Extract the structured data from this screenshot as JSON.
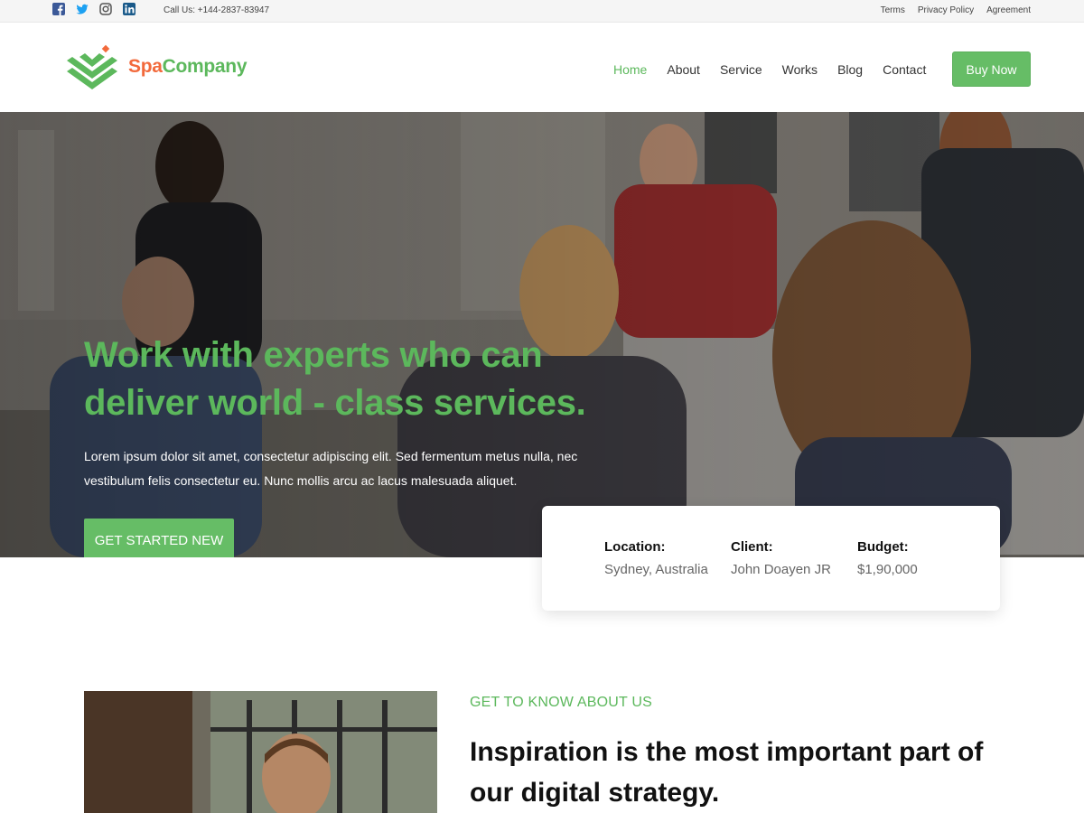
{
  "topbar": {
    "social_icons": [
      "facebook-icon",
      "twitter-icon",
      "instagram-icon",
      "linkedin-icon"
    ],
    "social_color": "#3b5998",
    "call_text": "Call Us: +144-2837-83947",
    "links": [
      "Terms",
      "Privacy Policy",
      "Agreement"
    ]
  },
  "header": {
    "logo": {
      "spa": "Spa",
      "company": "Company"
    },
    "nav": [
      "Home",
      "About",
      "Service",
      "Works",
      "Blog",
      "Contact"
    ],
    "active_nav": "Home",
    "buy_button": "Buy Now"
  },
  "hero": {
    "title": "Work with experts who can deliver world - class services.",
    "text": "Lorem ipsum dolor sit amet, consectetur adipiscing elit. Sed fermentum metus nulla, nec vestibulum felis consectetur eu. Nunc mollis arcu ac lacus malesuada aliquet.",
    "button": "GET STARTED NEW"
  },
  "info": {
    "location_label": "Location:",
    "location_value": "Sydney, Australia",
    "client_label": "Client:",
    "client_value": "John Doayen JR",
    "budget_label": "Budget:",
    "budget_value": "$1,90,000"
  },
  "about": {
    "eyebrow": "GET TO KNOW ABOUT US",
    "heading": "Inspiration is the most important part of our digital strategy."
  },
  "colors": {
    "accent": "#5cb85c",
    "brand_orange": "#f26a3c"
  }
}
